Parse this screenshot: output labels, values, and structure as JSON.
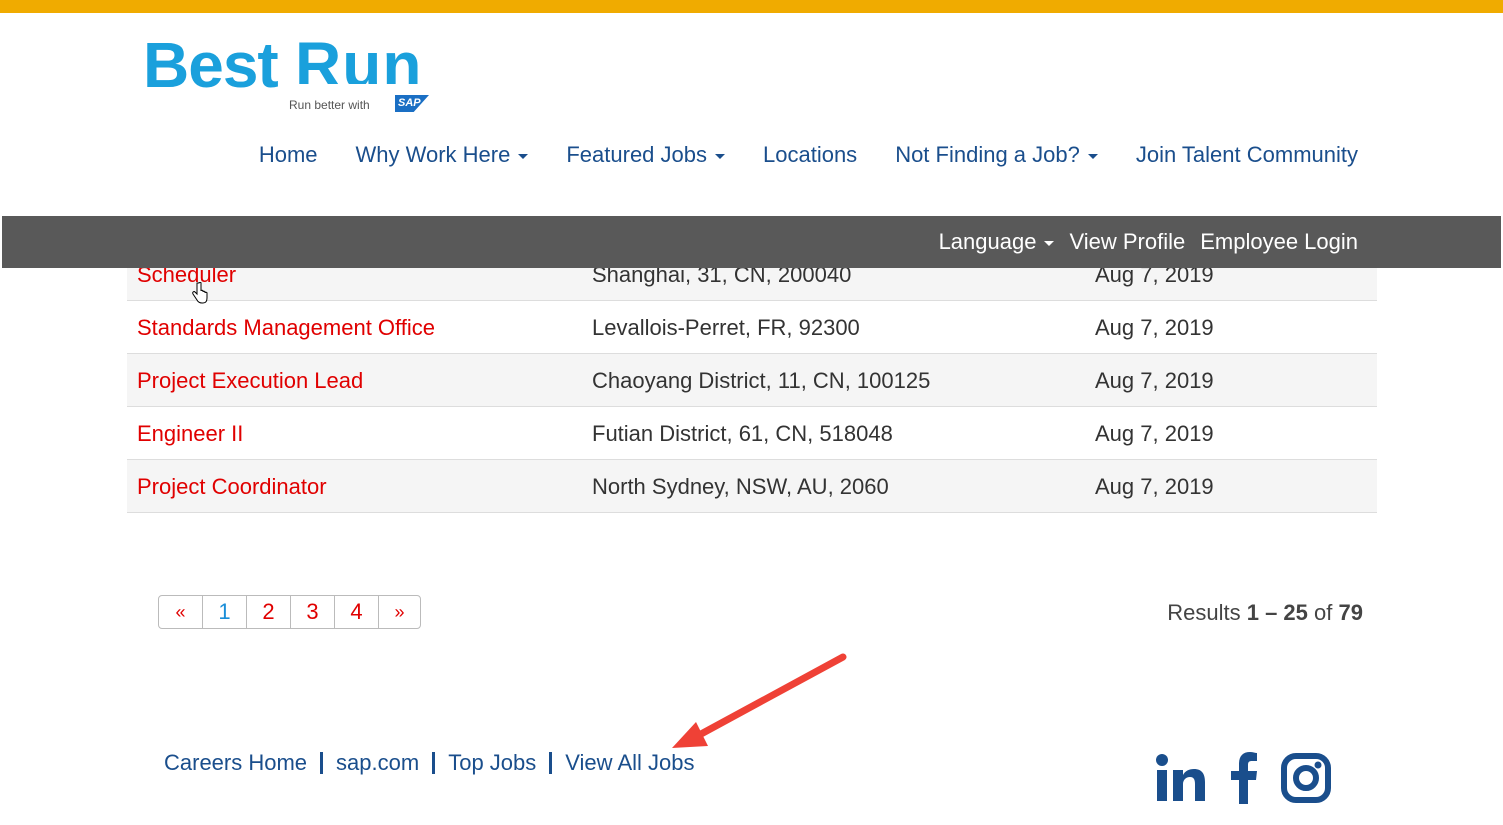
{
  "brand": {
    "logo_main": "Best",
    "logo_second": "Run",
    "tagline": "Run better with",
    "sap": "SAP"
  },
  "colors": {
    "top_bar": "#f0ab00",
    "nav_text": "#1a4e8c",
    "util_bar": "#595959",
    "job_link": "#e00000",
    "current_page": "#1a8ed8"
  },
  "main_nav": [
    {
      "label": "Home",
      "dropdown": false
    },
    {
      "label": "Why Work Here",
      "dropdown": true
    },
    {
      "label": "Featured Jobs",
      "dropdown": true
    },
    {
      "label": "Locations",
      "dropdown": false
    },
    {
      "label": "Not Finding a Job?",
      "dropdown": true
    },
    {
      "label": "Join Talent Community",
      "dropdown": false
    }
  ],
  "util_nav": {
    "language": "Language",
    "view_profile": "View Profile",
    "employee_login": "Employee Login"
  },
  "jobs": [
    {
      "title": "Scheduler",
      "location": "Shanghai, 31, CN, 200040",
      "date": "Aug 7, 2019"
    },
    {
      "title": "Standards Management Office",
      "location": "Levallois-Perret, FR, 92300",
      "date": "Aug 7, 2019"
    },
    {
      "title": "Project Execution Lead",
      "location": "Chaoyang District, 11, CN, 100125",
      "date": "Aug 7, 2019"
    },
    {
      "title": "Engineer II",
      "location": "Futian District, 61, CN, 518048",
      "date": "Aug 7, 2019"
    },
    {
      "title": "Project Coordinator",
      "location": "North Sydney, NSW, AU, 2060",
      "date": "Aug 7, 2019"
    }
  ],
  "pagination": {
    "prev": "«",
    "pages": [
      "1",
      "2",
      "3",
      "4"
    ],
    "next": "»",
    "current": "1"
  },
  "results": {
    "prefix": "Results",
    "range": "1 – 25",
    "of": "of",
    "total": "79"
  },
  "footer_links": [
    "Careers Home",
    "sap.com",
    "Top Jobs",
    "View All Jobs"
  ],
  "social": [
    "linkedin-icon",
    "facebook-icon",
    "instagram-icon"
  ]
}
